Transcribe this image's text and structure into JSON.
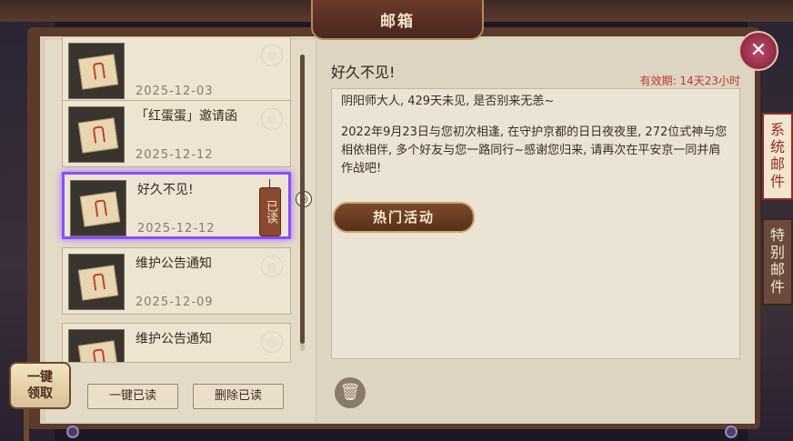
{
  "header": {
    "title": "邮箱"
  },
  "mails": [
    {
      "title": "",
      "date": "2025-12-03"
    },
    {
      "title": "「红蛋蛋」邀请函",
      "date": "2025-12-12"
    },
    {
      "title": "好久不见!",
      "date": "2025-12-12",
      "read_label": "已读"
    },
    {
      "title": "维护公告通知",
      "date": "2025-12-09"
    },
    {
      "title": "维护公告通知",
      "date": ""
    }
  ],
  "list_buttons": {
    "read_all": "一键已读",
    "delete_read": "删除已读",
    "claim_all": "一键领取"
  },
  "detail": {
    "title": "好久不见!",
    "validity": "有效期: 14天23小时",
    "greeting": "阴阳师大人, 429天未见, 是否别来无恙~",
    "body": "2022年9月23日与您初次相逢, 在守护京都的日日夜夜里, 272位式神与您相依相伴, 多个好友与您一路同行~感谢您归来, 请再次在平安京一同并肩作战吧!",
    "action_button": "热门活动"
  },
  "side_tabs": [
    "系统邮件",
    "特别邮件"
  ],
  "colors": {
    "selected_border": "#8a4dff",
    "validity": "#c0392b"
  }
}
